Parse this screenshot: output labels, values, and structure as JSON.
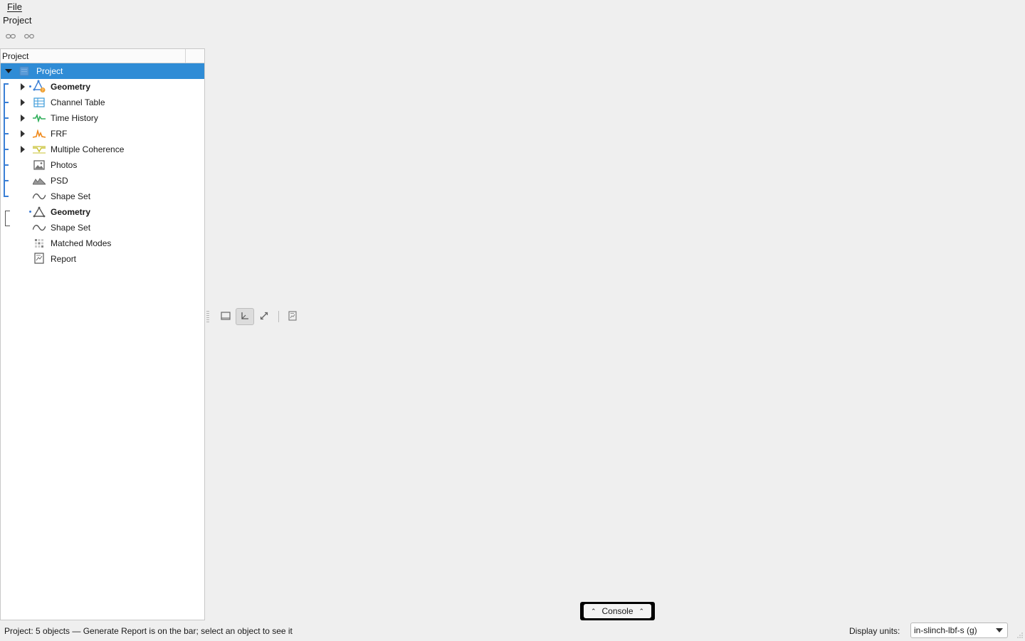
{
  "menu": {
    "file": "File"
  },
  "panel": {
    "title": "Project"
  },
  "toolbar": {
    "link_icon": "link-icon",
    "unlink_icon": "unlink-icon"
  },
  "tree": {
    "header": "Project",
    "root": {
      "label": "Project",
      "icon": "project-icon",
      "expanded": true
    },
    "items": [
      {
        "label": "Geometry",
        "icon": "geometry-warning-icon",
        "bold": true,
        "expandable": true
      },
      {
        "label": "Channel Table",
        "icon": "table-icon",
        "bold": false,
        "expandable": true
      },
      {
        "label": "Time History",
        "icon": "time-history-icon",
        "bold": false,
        "expandable": true
      },
      {
        "label": "FRF",
        "icon": "frf-icon",
        "bold": false,
        "expandable": true
      },
      {
        "label": "Multiple Coherence",
        "icon": "coherence-icon",
        "bold": false,
        "expandable": true
      },
      {
        "label": "Photos",
        "icon": "image-icon",
        "bold": false,
        "expandable": false
      },
      {
        "label": "PSD",
        "icon": "psd-icon",
        "bold": false,
        "expandable": false
      },
      {
        "label": "Shape Set",
        "icon": "shape-set-icon",
        "bold": false,
        "expandable": false
      },
      {
        "label": "Geometry",
        "icon": "geometry-icon",
        "bold": true,
        "expandable": false
      },
      {
        "label": "Shape Set",
        "icon": "shape-set-icon",
        "bold": false,
        "expandable": false
      },
      {
        "label": "Matched Modes",
        "icon": "matched-modes-icon",
        "bold": false,
        "expandable": false
      },
      {
        "label": "Report",
        "icon": "report-icon",
        "bold": false,
        "expandable": false
      }
    ]
  },
  "view_toolbar": {
    "buttons": [
      "frame-icon",
      "axes-icon",
      "diagonal-icon",
      "report-icon"
    ]
  },
  "console": {
    "label": "Console"
  },
  "status": {
    "text": "Project: 5 objects — Generate Report is on the bar; select an object to see it"
  },
  "units": {
    "label": "Display units:",
    "selected": "in-slinch-lbf-s (g)"
  },
  "colors": {
    "selection": "#2f8cd6",
    "bracket": "#3a7fd5"
  }
}
